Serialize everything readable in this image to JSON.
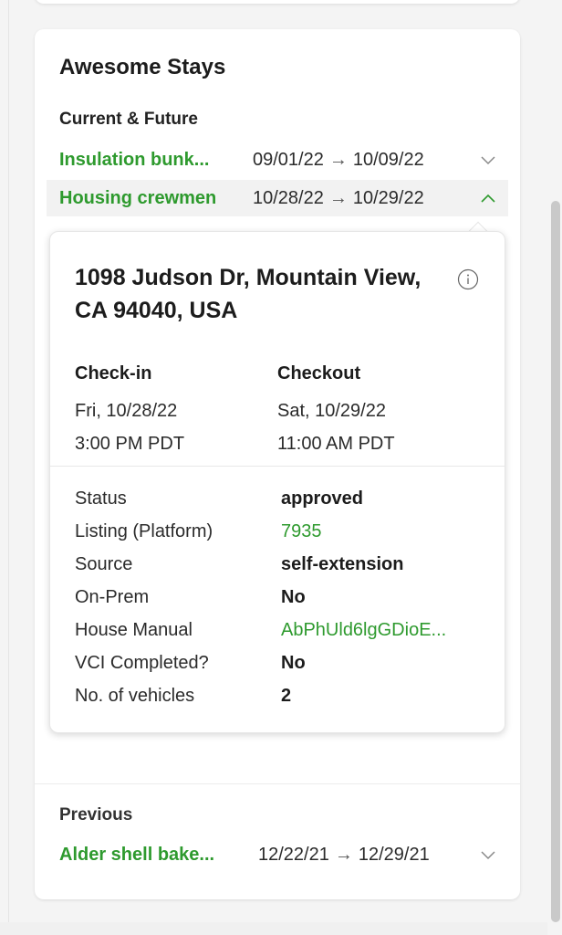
{
  "stays_card": {
    "title": "Awesome Stays",
    "current_label": "Current & Future",
    "previous_label": "Previous",
    "current_stays": [
      {
        "name": "Insulation bunk...",
        "start": "09/01/22",
        "end": "10/09/22",
        "expanded": false
      },
      {
        "name": "Housing crewmen",
        "start": "10/28/22",
        "end": "10/29/22",
        "expanded": true
      }
    ],
    "previous_stays": [
      {
        "name": "Alder shell bake...",
        "start": "12/22/21",
        "end": "12/29/21",
        "expanded": false
      }
    ],
    "arrow_glyph": "→"
  },
  "stay_detail": {
    "address": "1098 Judson Dr, Mountain View, CA 94040, USA",
    "checkin": {
      "label": "Check-in",
      "date": "Fri, 10/28/22",
      "time": "3:00 PM PDT"
    },
    "checkout": {
      "label": "Checkout",
      "date": "Sat, 10/29/22",
      "time": "11:00 AM PDT"
    },
    "details": [
      {
        "label": "Status",
        "value": "approved",
        "is_link": false
      },
      {
        "label": "Listing (Platform)",
        "value": "7935",
        "is_link": true
      },
      {
        "label": "Source",
        "value": "self-extension",
        "is_link": false
      },
      {
        "label": "On-Prem",
        "value": "No",
        "is_link": false
      },
      {
        "label": "House Manual",
        "value": "AbPhUld6lgGDioE...",
        "is_link": true
      },
      {
        "label": "VCI Completed?",
        "value": "No",
        "is_link": false
      },
      {
        "label": "No. of vehicles",
        "value": "2",
        "is_link": false
      }
    ]
  },
  "colors": {
    "accent_green": "#2e9a2e",
    "text": "#1c1c1c",
    "background": "#f4f4f4"
  },
  "icons": {
    "info": "info-icon",
    "expand": "chevron-down-icon",
    "collapse": "chevron-up-icon"
  }
}
